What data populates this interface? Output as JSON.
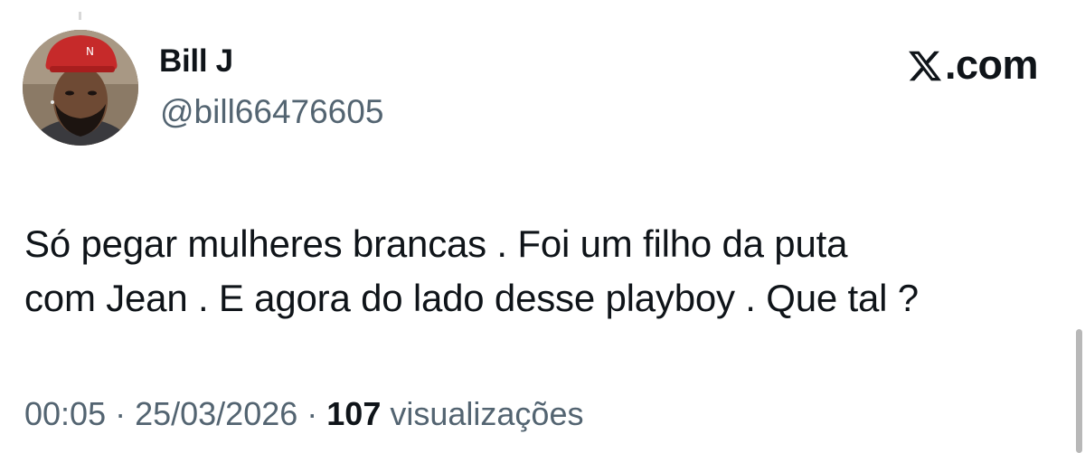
{
  "author": {
    "display_name": "Bill J",
    "handle": "@bill66476605",
    "avatar_icon": "profile-photo"
  },
  "brand": {
    "label": ".com",
    "icon": "x-logo-icon"
  },
  "tweet": {
    "text": "Só pegar mulheres brancas . Foi um filho da puta\ncom Jean . E agora do lado desse playboy . Que tal ?"
  },
  "meta": {
    "time": "00:05",
    "separator": " · ",
    "date": "25/03/2026",
    "views_count": "107",
    "views_label": "visualizações"
  },
  "colors": {
    "text": "#0f1419",
    "secondary": "#536471",
    "background": "#ffffff"
  }
}
